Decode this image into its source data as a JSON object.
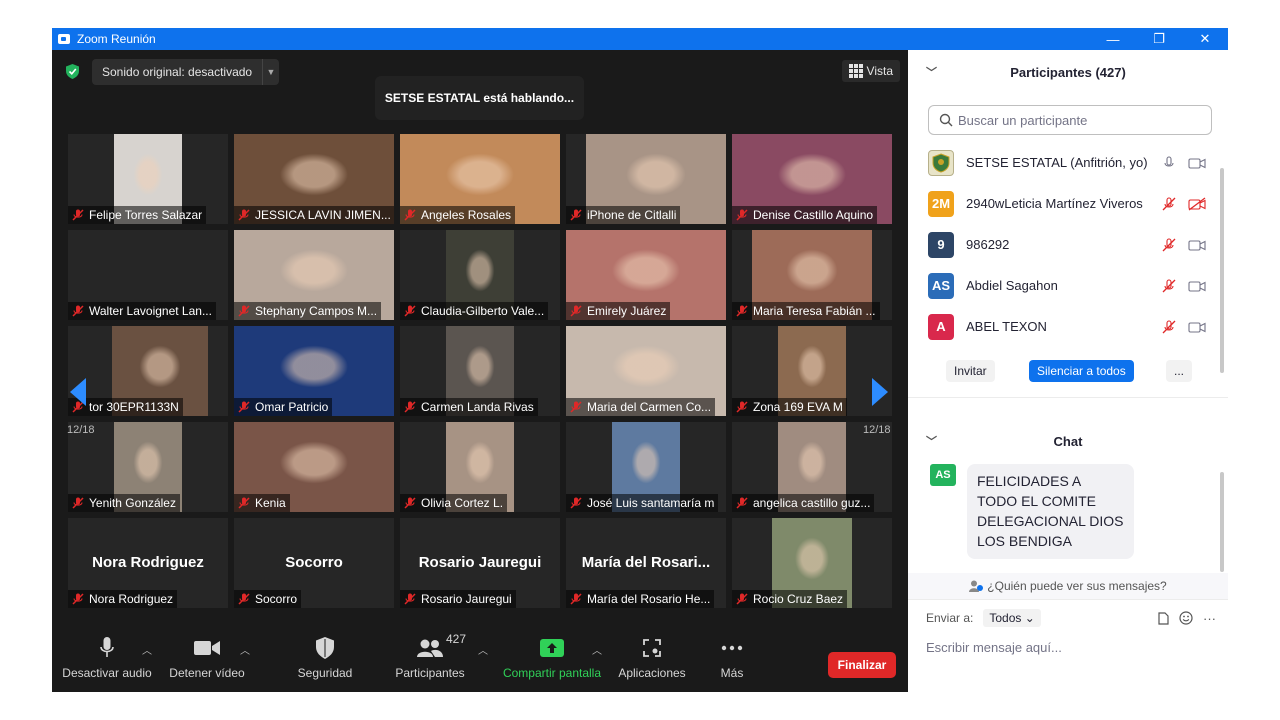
{
  "window": {
    "title": "Zoom Reunión",
    "minimize": "—",
    "restore": "❐",
    "close": "✕"
  },
  "meeting": {
    "audio_label": "Sonido original: desactivado",
    "speaking": "SETSE ESTATAL está hablando...",
    "view_label": "Vista",
    "page_left": "12/18",
    "page_right": "12/18"
  },
  "tiles": [
    {
      "name": "Felipe Torres Salazar",
      "photo": "#d7d3cf",
      "bg": "#262626"
    },
    {
      "name": "JESSICA LAVIN JIMEN...",
      "photo": "#6e4f3a",
      "bg": "#5a3b2c"
    },
    {
      "name": "Angeles Rosales",
      "photo": "#c28a5a",
      "bg": "#b9834f"
    },
    {
      "name": "iPhone de Citlalli",
      "photo": "#a89486",
      "bg": "#262626"
    },
    {
      "name": "Denise Castillo Aquino",
      "photo": "#8a4a62",
      "bg": "#7d3e57"
    },
    {
      "name": "Walter Lavoignet Lan...",
      "photo": "",
      "bg": "#262626"
    },
    {
      "name": "Stephany Campos M...",
      "photo": "#b8a89c",
      "bg": "#b5a597"
    },
    {
      "name": "Claudia-Gilberto Vale...",
      "photo": "#3e3f36",
      "bg": "#262626"
    },
    {
      "name": "Emirely Juárez",
      "photo": "#b5736b",
      "bg": "#a8625e"
    },
    {
      "name": "Maria Teresa Fabián ...",
      "photo": "#9d6b58",
      "bg": "#262626"
    },
    {
      "name": "tor 30EPR1133N",
      "photo": "#6a5141",
      "bg": "#262626"
    },
    {
      "name": "Omar Patricio",
      "photo": "#1e3a7a",
      "bg": "#14214a"
    },
    {
      "name": "Carmen Landa Rivas",
      "photo": "#5b5550",
      "bg": "#262626"
    },
    {
      "name": "Maria del Carmen Co...",
      "photo": "#c7b9ad",
      "bg": "#bfb1a4"
    },
    {
      "name": "Zona 169 EVA M",
      "photo": "#8c6a50",
      "bg": "#262626"
    },
    {
      "name": "Yenith González",
      "photo": "#8d8275",
      "bg": "#262626"
    },
    {
      "name": "Kenia",
      "photo": "#7a5548",
      "bg": "#6b4a3d"
    },
    {
      "name": "Olivia Cortez L.",
      "photo": "#a79384",
      "bg": "#262626"
    },
    {
      "name": "José Luis santamaría m",
      "photo": "#5e7aa0",
      "bg": "#262626"
    },
    {
      "name": "angelica castillo guz...",
      "photo": "#a08c80",
      "bg": "#262626"
    },
    {
      "name": "Nora Rodriguez",
      "bigname": "Nora Rodriguez",
      "photo": "",
      "bg": "#262626"
    },
    {
      "name": "Socorro",
      "bigname": "Socorro",
      "photo": "",
      "bg": "#262626"
    },
    {
      "name": "Rosario Jauregui",
      "bigname": "Rosario Jauregui",
      "photo": "",
      "bg": "#262626"
    },
    {
      "name": "María del Rosario He...",
      "bigname": "María del Rosari...",
      "photo": "",
      "bg": "#262626"
    },
    {
      "name": "Rocio Cruz Baez",
      "photo": "#7f8a6a",
      "bg": "#262626"
    }
  ],
  "toolbar": {
    "mute": "Desactivar audio",
    "video": "Detener vídeo",
    "security": "Seguridad",
    "participants": "Participantes",
    "participants_count": "427",
    "share": "Compartir pantalla",
    "apps": "Aplicaciones",
    "more": "Más",
    "end": "Finalizar"
  },
  "participants_panel": {
    "title": "Participantes (427)",
    "search_placeholder": "Buscar un participante",
    "invite": "Invitar",
    "mute_all": "Silenciar a todos",
    "more": "...",
    "list": [
      {
        "initials": "",
        "name": "SETSE ESTATAL (Anfitrión, yo)",
        "color": "#e8e4c8",
        "mic_on": true
      },
      {
        "initials": "2M",
        "name": "2940wLeticia Martínez Viveros",
        "color": "#f0a21b",
        "mic_on": false
      },
      {
        "initials": "9",
        "name": "986292",
        "color": "#2d4566",
        "mic_on": false
      },
      {
        "initials": "AS",
        "name": "Abdiel Sagahon",
        "color": "#2b6cb8",
        "mic_on": false
      },
      {
        "initials": "A",
        "name": "ABEL TEXON",
        "color": "#d9284c",
        "mic_on": false
      }
    ]
  },
  "chat": {
    "title": "Chat",
    "sender_initials": "AS",
    "message": "FELICIDADES A TODO EL COMITE DELEGACIONAL DIOS LOS BENDIGA",
    "who_can_see": "¿Quién puede ver sus mensajes?",
    "send_to_label": "Enviar a:",
    "send_to_value": "Todos",
    "input_placeholder": "Escribir mensaje aquí..."
  }
}
